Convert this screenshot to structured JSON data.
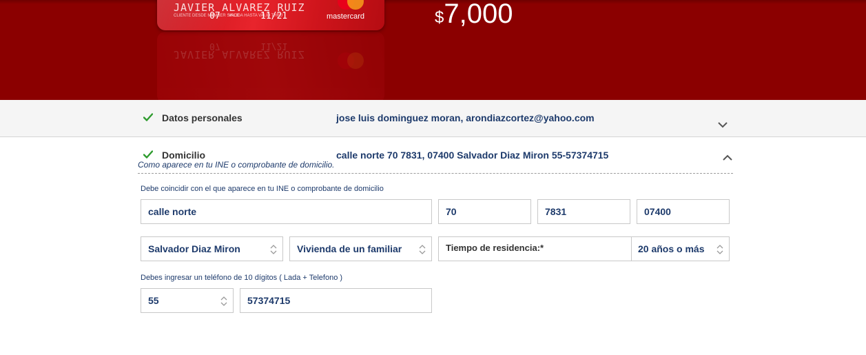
{
  "hero": {
    "card": {
      "name": "JAVIER ALVAREZ RUIZ",
      "member_since_label": "CLIENTE DESDE MEMBER SINCE",
      "member_since_value": "07",
      "valid_thru_label": "VALIDA HASTA VALID THRU",
      "valid_thru_value": "11/21",
      "brand": "mastercard"
    },
    "amount_currency": "$",
    "amount_value": "7,000"
  },
  "sections": {
    "personal": {
      "title": "Datos personales",
      "summary": "jose luis dominguez moran, arondiazcortez@yahoo.com",
      "expanded": false
    },
    "address": {
      "title": "Domicilio",
      "summary": "calle norte 70 7831, 07400 Salvador Diaz Miron 55-57374715",
      "hint": "Como aparece en tu INE o comprobante de domicilio.",
      "expanded": true
    }
  },
  "address_form": {
    "match_label": "Debe coincidir con el que aparece en tu INE o comprobante de domicilio",
    "street": "calle norte",
    "ext_number": "70",
    "int_number": "7831",
    "postal_code": "07400",
    "colony": "Salvador Diaz Miron",
    "housing_type": "Vivienda de un familiar",
    "residence_label": "Tiempo de residencia:*",
    "residence_time": "20 años o más",
    "phone_label": "Debes ingresar un teléfono de 10 dígitos ( Lada + Telefono )",
    "phone_area": "55",
    "phone_number": "57374715"
  },
  "colors": {
    "banner": "#8b0000",
    "check": "#2e9b2e",
    "value_text": "#1d3a6b"
  },
  "icons": {
    "check": "check-icon",
    "expand": "chevron-down-icon",
    "collapse": "chevron-up-icon",
    "select": "select-arrows-icon"
  }
}
